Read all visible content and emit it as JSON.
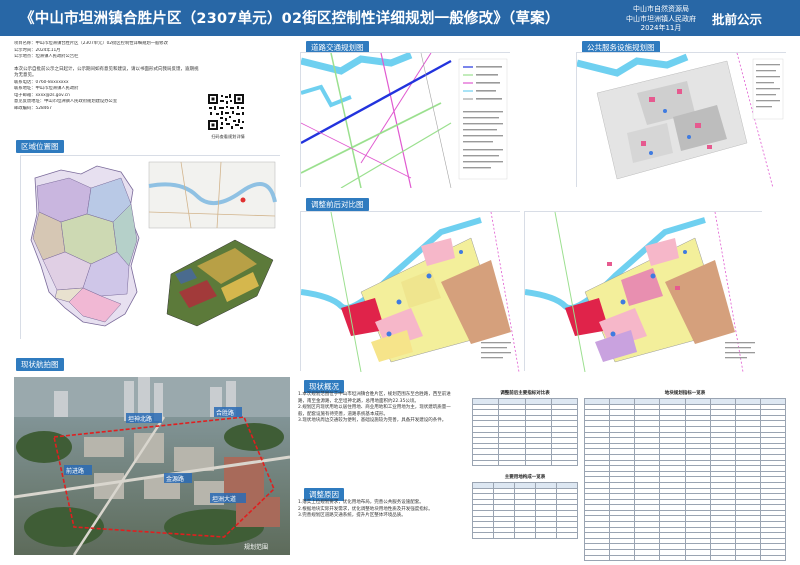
{
  "header": {
    "title": "《中山市坦洲镇合胜片区（2307单元）02街区控制性详细规划一般修改》（草案）",
    "org_lines": [
      "中山市自然资源局",
      "中山市坦洲镇人民政府",
      "2024年11月"
    ],
    "notice": "批前公示"
  },
  "info": {
    "lines": [
      "项目名称：中山市坦洲镇合胜片区（2307单元）02街区控制性详细规划一般修改",
      "公示时间：2024年11月",
      "公示地点：坦洲镇人民政府公告栏",
      "",
      "本次公示自批前公示之日起计，公示期间如有意见和建议，请以书面形式向我局反馈，逾期视为无意见。",
      "联系电话：0760-8xxxxxxx",
      "联系地址：中山市坦洲镇人民政府",
      "电子邮箱：xxxx@zs.gov.cn",
      "意见反馈地址：中山市坦洲镇人民政府规划建设办公室",
      "邮政编码：528467"
    ],
    "qr_caption": "扫码查看规划详情"
  },
  "sections": {
    "location": "区域位置图",
    "road": "道路交通规划图",
    "public": "公共服务设施规划图",
    "compare": "调整前后对比图",
    "status": "现状航拍图",
    "overview": "现状概况",
    "adjust": "调整原因",
    "table_before": "调整前后主要指标对比表",
    "table_summary": "地块规划指标一览表",
    "table_land": "主要用地构成一览表"
  },
  "overview": {
    "paragraphs": [
      "1.本次规划范围位于中山市坦洲镇合胜片区，规划范围东至合胜路，西至前进路，南至金源路，北至坦神北路，总用地面积约22.35公顷。",
      "2.规划区内现状用地以居住用地、商业用地和工业用地为主，现状建筑质量一般，配套设施有待完善，道路系统基本成形。",
      "3.现状地块周边交通较为便利，基础设施较为完善，具备开发建设的条件。"
    ]
  },
  "adjust": {
    "paragraphs": [
      "1.落实上位规划要求，优化用地布局，完善公共服务设施配套。",
      "2.根据地块实际开发需求，优化调整地块用地性质及开发强度指标。",
      "3.完善规划区道路交通系统，提升片区整体环境品质。"
    ]
  },
  "aerial_labels": [
    "坦神北路",
    "合胜路",
    "前进路",
    "金源路",
    "坦洲大道",
    "规划范围"
  ]
}
